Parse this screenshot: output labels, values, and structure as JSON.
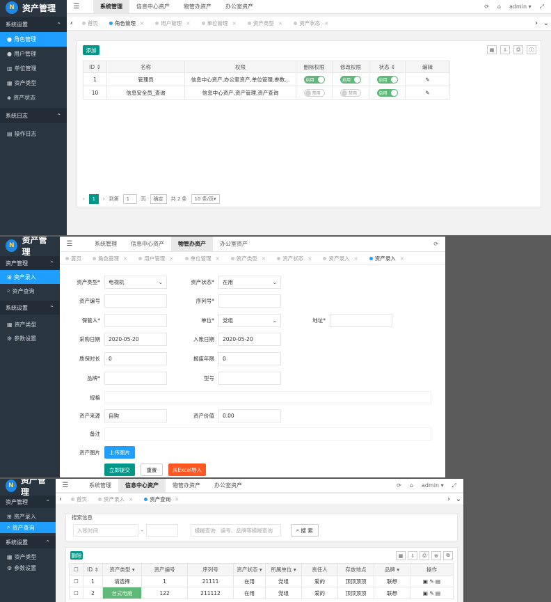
{
  "app": {
    "title": "资产管理",
    "user": "admin"
  },
  "icons": {
    "menu": "hamburger-icon",
    "refresh": "refresh-icon",
    "home": "home-icon",
    "fullscreen": "fullscreen-icon",
    "edit": "pencil-icon"
  },
  "colors": {
    "sidebar": "#2a3542",
    "active": "#1e9fff",
    "green": "#009688",
    "switch_on": "#5fb878",
    "orange": "#ff5722"
  },
  "header": {
    "tabs": [
      "系统管理",
      "信息中心资产",
      "物管办资产",
      "办公室资产"
    ]
  },
  "s1": {
    "sidebar": {
      "group1": "系统设置",
      "items": [
        "角色管理",
        "用户管理",
        "单位管理",
        "资产类型",
        "资产状态"
      ],
      "group2": "系统日志",
      "items2": [
        "操作日志"
      ]
    },
    "tabs": [
      "首页",
      "角色管理",
      "用户管理",
      "单位管理",
      "资产类型",
      "资产状态"
    ],
    "add": "添加",
    "columns": [
      "ID",
      "名称",
      "权限",
      "删除权限",
      "修改权限",
      "状态",
      "编辑"
    ],
    "rows": [
      {
        "id": "1",
        "name": "管理员",
        "perm": "信息中心资产,办公室资产,单位管理,参数...",
        "del": "启用",
        "mod": "启用",
        "st": "启用"
      },
      {
        "id": "10",
        "name": "信息安全员_查询",
        "perm": "信息中心资产,资产管理,资产查询",
        "del": "禁用",
        "mod": "禁用",
        "st": "启用"
      }
    ],
    "pager": {
      "page": "1",
      "goto": "到第",
      "page_val": "1",
      "page_unit": "页",
      "ok": "确定",
      "total": "共 2 条",
      "size": "10 条/页"
    }
  },
  "s2": {
    "sidebar": {
      "group1": "资产管理",
      "items": [
        "资产录入",
        "资产查询"
      ],
      "group2": "系统设置",
      "items2": [
        "资产类型",
        "参数设置"
      ]
    },
    "tabs": [
      "首页",
      "角色管理",
      "用户管理",
      "单位管理",
      "资产类型",
      "资产状态",
      "资产录入",
      "资产录入"
    ],
    "form": {
      "type_l": "资产类型*",
      "type_v": "电视机",
      "status_l": "资产状态*",
      "status_v": "在用",
      "code_l": "资产编号",
      "serial_l": "序列号*",
      "keeper_l": "保管人*",
      "unit_l": "单位*",
      "unit_v": "党组",
      "addr_l": "地址*",
      "buy_l": "采购日期",
      "buy_v": "2020-05-20",
      "in_l": "入账日期",
      "in_v": "2020-05-20",
      "warranty_l": "质保时长",
      "warranty_v": "0",
      "scrap_l": "报废年限",
      "scrap_v": "0",
      "brand_l": "品牌*",
      "model_l": "型号",
      "spec_l": "规格",
      "source_l": "资产来源",
      "source_v": "自购",
      "value_l": "资产价值",
      "value_v": "0.00",
      "remark_l": "备注",
      "img_l": "资产图片",
      "upload": "上传图片",
      "submit": "立即提交",
      "reset": "重置",
      "excel": "从Excel导入"
    }
  },
  "s3": {
    "sidebar": {
      "group1": "资产管理",
      "items": [
        "资产录入",
        "资产查询"
      ],
      "group2": "系统设置",
      "items2": [
        "资产类型",
        "参数设置"
      ]
    },
    "tabs": [
      "首页",
      "资产录入",
      "资产查询"
    ],
    "search": {
      "legend": "搜索信息",
      "date_ph": "入账时间",
      "dash": "-",
      "fuzzy": "模糊查询",
      "fuzzy_ph": "编号、品牌等模糊查询",
      "btn": "搜 索"
    },
    "del": "删除",
    "columns": [
      "",
      "ID",
      "资产类型",
      "资产编号",
      "序列号",
      "资产状态",
      "所属单位",
      "责任人",
      "存放地点",
      "品牌",
      "操作"
    ],
    "rows": [
      {
        "id": "1",
        "type": "请选择",
        "code": "1",
        "serial": "21111",
        "status": "在用",
        "unit": "党组",
        "person": "爱的",
        "place": "顶顶顶顶",
        "brand": "联想"
      },
      {
        "id": "2",
        "type": "台式电脑",
        "code": "122",
        "serial": "211112",
        "status": "在用",
        "unit": "党组",
        "person": "爱的",
        "place": "顶顶顶顶",
        "brand": "联想"
      }
    ]
  }
}
